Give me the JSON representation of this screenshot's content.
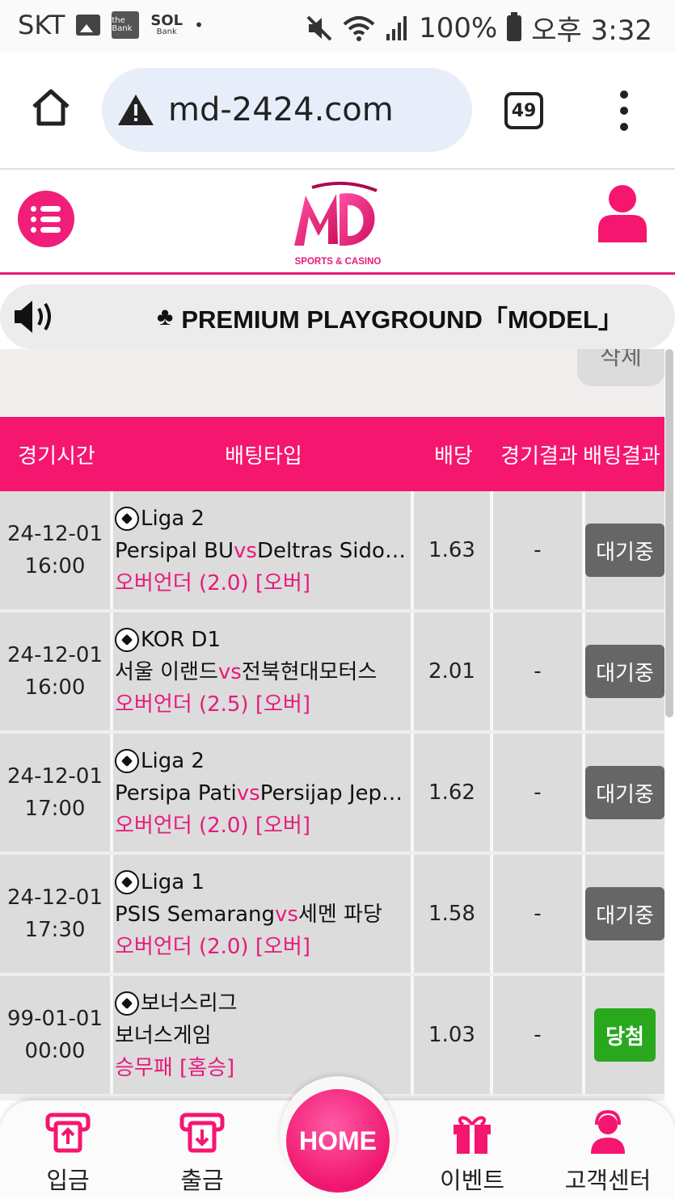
{
  "status_bar": {
    "carrier": "SKT",
    "bank_icon_text": "the Bank",
    "sol_text": "SOL",
    "sol_sub": "Bank",
    "battery": "100%",
    "time": "오후 3:32"
  },
  "browser": {
    "url": "md-2424.com",
    "tab_count": "49"
  },
  "header": {
    "logo_text": "MD",
    "logo_sub": "SPORTS & CASINO"
  },
  "notice": {
    "symbol": "♣",
    "text": "PREMIUM PLAYGROUND「MODEL」"
  },
  "delete_label": "삭제",
  "table": {
    "headers": [
      "경기시간",
      "배팅타입",
      "배당",
      "경기결과",
      "배팅결과"
    ],
    "rows": [
      {
        "date": "24-12-01",
        "time": "16:00",
        "league": "Liga 2",
        "home": "Persipal BU",
        "vs": "vs",
        "away": "Deltras Sidoarjo",
        "pick": "오버언더 (2.0) [오버]",
        "odds": "1.63",
        "result": "-",
        "status": "대기중"
      },
      {
        "date": "24-12-01",
        "time": "16:00",
        "league": "KOR D1",
        "home": "서울 이랜드",
        "vs": "vs",
        "away": "전북현대모터스",
        "pick": "오버언더 (2.5) [오버]",
        "odds": "2.01",
        "result": "-",
        "status": "대기중"
      },
      {
        "date": "24-12-01",
        "time": "17:00",
        "league": "Liga 2",
        "home": "Persipa Pati",
        "vs": "vs",
        "away": "Persijap Jepara",
        "pick": "오버언더 (2.0) [오버]",
        "odds": "1.62",
        "result": "-",
        "status": "대기중"
      },
      {
        "date": "24-12-01",
        "time": "17:30",
        "league": "Liga 1",
        "home": "PSIS Semarang",
        "vs": "vs",
        "away": "세멘 파당",
        "pick": "오버언더 (2.0) [오버]",
        "odds": "1.58",
        "result": "-",
        "status": "대기중"
      },
      {
        "date": "99-01-01",
        "time": "00:00",
        "league": "보너스리그",
        "home": "보너스게임",
        "vs": "",
        "away": "",
        "pick": "승무패 [홈승]",
        "odds": "1.03",
        "result": "-",
        "status": "당첨"
      }
    ]
  },
  "bottom_nav": {
    "deposit": "입금",
    "withdraw": "출금",
    "home": "HOME",
    "event": "이벤트",
    "support": "고객센터"
  },
  "colors": {
    "brand_pink": "#f5166f",
    "win_green": "#29a81e",
    "pending_gray": "#666666"
  }
}
